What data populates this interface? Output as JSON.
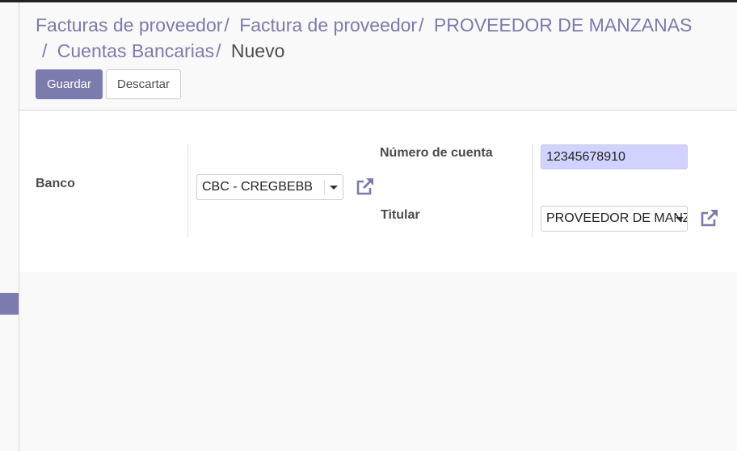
{
  "breadcrumb": {
    "item1": "Facturas de proveedor",
    "item2": "Factura de proveedor",
    "item3": "PROVEEDOR DE MANZANAS",
    "item4": "Cuentas Bancarias",
    "current": "Nuevo",
    "separator": "/"
  },
  "buttons": {
    "save": "Guardar",
    "discard": "Descartar"
  },
  "form": {
    "bank_label": "Banco",
    "bank_value": "CBC - CREGBEBB",
    "account_number_label": "Número de cuenta",
    "account_number_value": "12345678910",
    "holder_label": "Titular",
    "holder_value": "PROVEEDOR DE MANZANAS"
  },
  "colors": {
    "accent": "#7c7bad",
    "highlight_input": "#d2d2ff"
  },
  "icons": {
    "external_link": "external-link-icon",
    "caret": "chevron-down-icon"
  }
}
